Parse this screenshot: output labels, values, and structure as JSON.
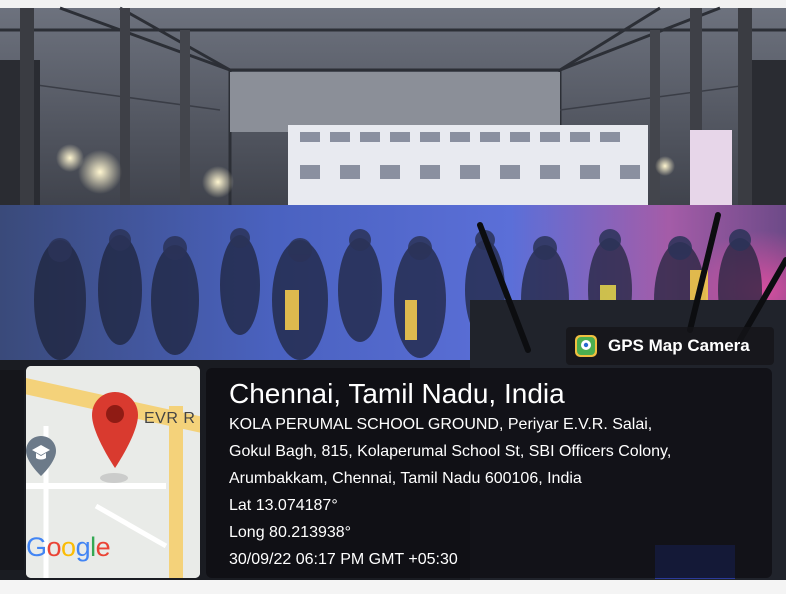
{
  "badge": {
    "label": "GPS Map Camera",
    "icon": "gps-map-camera-icon"
  },
  "location": {
    "title": "Chennai, Tamil Nadu, India",
    "address_lines": [
      "KOLA PERUMAL SCHOOL GROUND, Periyar E.V.R. Salai,",
      "Gokul Bagh, 815, Kolaperumal School St, SBI Officers Colony,",
      "Arumbakkam, Chennai, Tamil Nadu 600106, India"
    ],
    "lat": "Lat 13.074187°",
    "long": "Long 80.213938°",
    "datetime": "30/09/22 06:17 PM GMT +05:30"
  },
  "map": {
    "road_label": "EVR R",
    "provider": "Google",
    "pin_color": "#d93a2f",
    "icons": [
      "map-pin-icon",
      "school-icon"
    ]
  },
  "colors": {
    "panel_bg": "#0c0c10",
    "text": "#ffffff",
    "map_road_yellow": "#f4d27a",
    "map_bg": "#e9ebe8"
  }
}
